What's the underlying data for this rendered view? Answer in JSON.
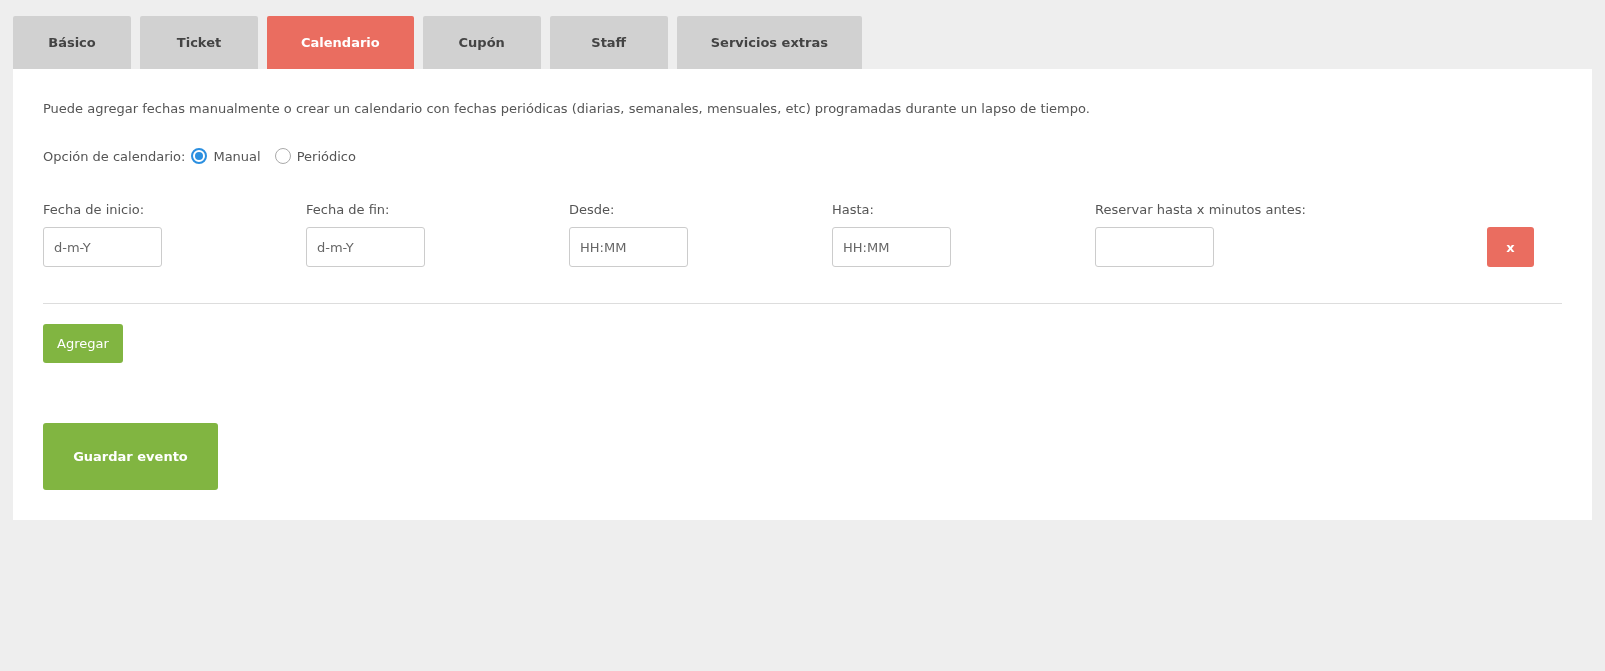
{
  "tabs": [
    {
      "label": "Básico",
      "selected": false
    },
    {
      "label": "Ticket",
      "selected": false
    },
    {
      "label": "Calendario",
      "selected": true
    },
    {
      "label": "Cupón",
      "selected": false
    },
    {
      "label": "Staff",
      "selected": false
    },
    {
      "label": "Servicios extras",
      "selected": false
    }
  ],
  "description": "Puede agregar fechas manualmente o crear un calendario con fechas periódicas (diarias, semanales, mensuales, etc) programadas durante un lapso de tiempo.",
  "calendar_option": {
    "label": "Opción de calendario:",
    "options": [
      {
        "label": "Manual",
        "selected": true
      },
      {
        "label": "Periódico",
        "selected": false
      }
    ]
  },
  "date_row": {
    "fields": [
      {
        "label": "Fecha de inicio:",
        "placeholder": "d-m-Y"
      },
      {
        "label": "Fecha de fin:",
        "placeholder": "d-m-Y"
      },
      {
        "label": "Desde:",
        "placeholder": "HH:MM"
      },
      {
        "label": "Hasta:",
        "placeholder": "HH:MM"
      },
      {
        "label": "Reservar hasta x minutos antes:"
      }
    ],
    "remove_button": "x"
  },
  "add_button": "Agregar",
  "save_button": "Guardar evento"
}
